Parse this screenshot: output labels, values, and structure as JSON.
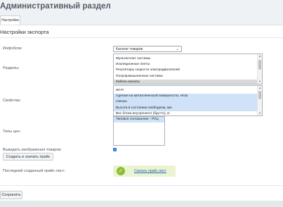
{
  "page": {
    "title": "Административный раздел",
    "tab_label": "Настройки"
  },
  "section": {
    "title": "Настройки экспорта"
  },
  "fields": {
    "iblock_label": "Инфоблок:",
    "iblock_value": "Каталог товаров",
    "sections_label": "Разделы:",
    "properties_label": "Свойства:",
    "prices_label": "Типы цен:",
    "export_images_label": "Выводить изображения товаров:",
    "last_pricelist_label": "Последний созданный прайс-лист:"
  },
  "sections_list": [
    {
      "label": "Мультисплит системы",
      "selected": false
    },
    {
      "label": "Изоляционные ленты",
      "selected": false
    },
    {
      "label": "Регуляторы скорости электродвигателей",
      "selected": false
    },
    {
      "label": "Полупромышленные системы",
      "selected": false
    },
    {
      "label": "Кабель-каналы",
      "selected": true
    }
  ],
  "properties_list": [
    {
      "label": "Wi-Fi",
      "selected": false
    },
    {
      "label": "Адгезия на металлической поверхности, Н/см",
      "selected": true
    },
    {
      "label": "Связка",
      "selected": true
    },
    {
      "label": "Высота в состоянии свободном, мм",
      "selected": true
    },
    {
      "label": "Вес блока внутреннего (брутто), кг",
      "selected": false
    }
  ],
  "prices_list": [
    {
      "label": "Типовое соглашение - РУЦ",
      "selected": true
    }
  ],
  "buttons": {
    "create_download": "Создать и скачать прайс",
    "save": "Сохранить"
  },
  "download": {
    "link_text": "Скачать прайс-лист"
  },
  "export_images_checked": true,
  "icons": {
    "favorite": "star-icon",
    "select_caret": "chevron-down-icon",
    "success": "check-circle-icon"
  },
  "colors": {
    "accent": "#2b7cd3",
    "selection": "#cfe2f7",
    "success": "#8cbd33"
  }
}
